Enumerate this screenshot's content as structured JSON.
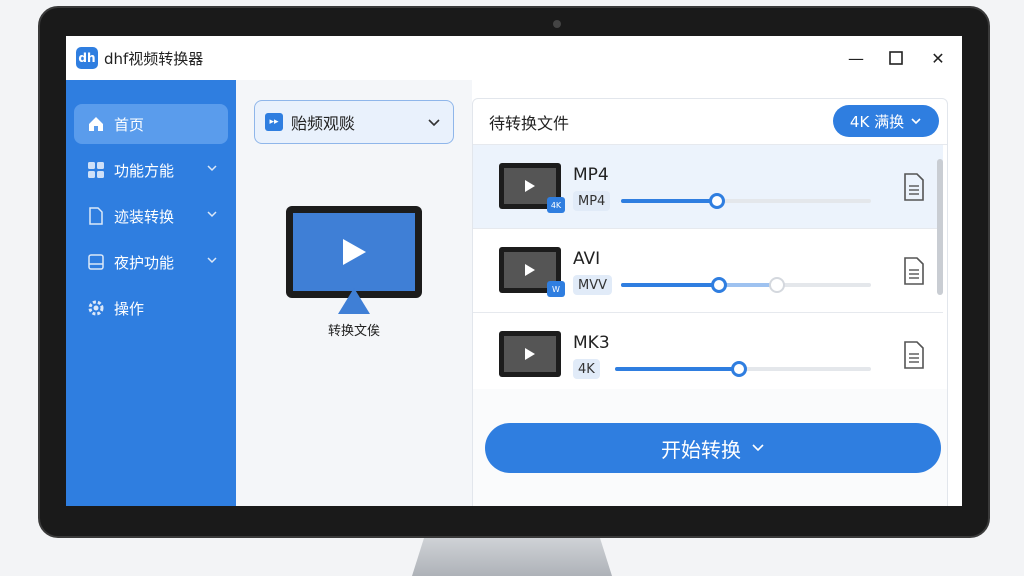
{
  "app": {
    "logo_text": "dh",
    "title": "dhf视频转换器"
  },
  "window_controls": {
    "minimize": "—",
    "maximize": "☐",
    "close": "✕"
  },
  "sidebar": {
    "items": [
      {
        "label": "首页",
        "icon": "home-icon",
        "active": true,
        "has_caret": false
      },
      {
        "label": "功能方能",
        "icon": "grid-icon",
        "active": false,
        "has_caret": true
      },
      {
        "label": "迹装转换",
        "icon": "document-icon",
        "active": false,
        "has_caret": true
      },
      {
        "label": "夜护功能",
        "icon": "storage-icon",
        "active": false,
        "has_caret": true
      },
      {
        "label": "操作",
        "icon": "gear-icon",
        "active": false,
        "has_caret": false
      }
    ]
  },
  "source": {
    "selected": "贻频观赕",
    "icon_text": "▸▸"
  },
  "preview": {
    "caption": "转换文俟"
  },
  "file_panel": {
    "title": "待转换文件",
    "quality_label": "4K 满换",
    "files": [
      {
        "name": "MP4",
        "tag": "MP4",
        "badge": "4K",
        "progress": 0.32,
        "second_knob": null,
        "selected": true
      },
      {
        "name": "AVI",
        "tag": "MVV",
        "badge": "W",
        "progress": 0.32,
        "second_knob": 0.5,
        "selected": false
      },
      {
        "name": "MK3",
        "tag": "4K",
        "badge": "",
        "progress": 0.35,
        "second_knob": null,
        "selected": false
      }
    ]
  },
  "actions": {
    "start_label": "开始转换",
    "start_icon": "✓"
  },
  "colors": {
    "accent": "#2f7ee0",
    "sidebar_active": "#5a9cec"
  }
}
